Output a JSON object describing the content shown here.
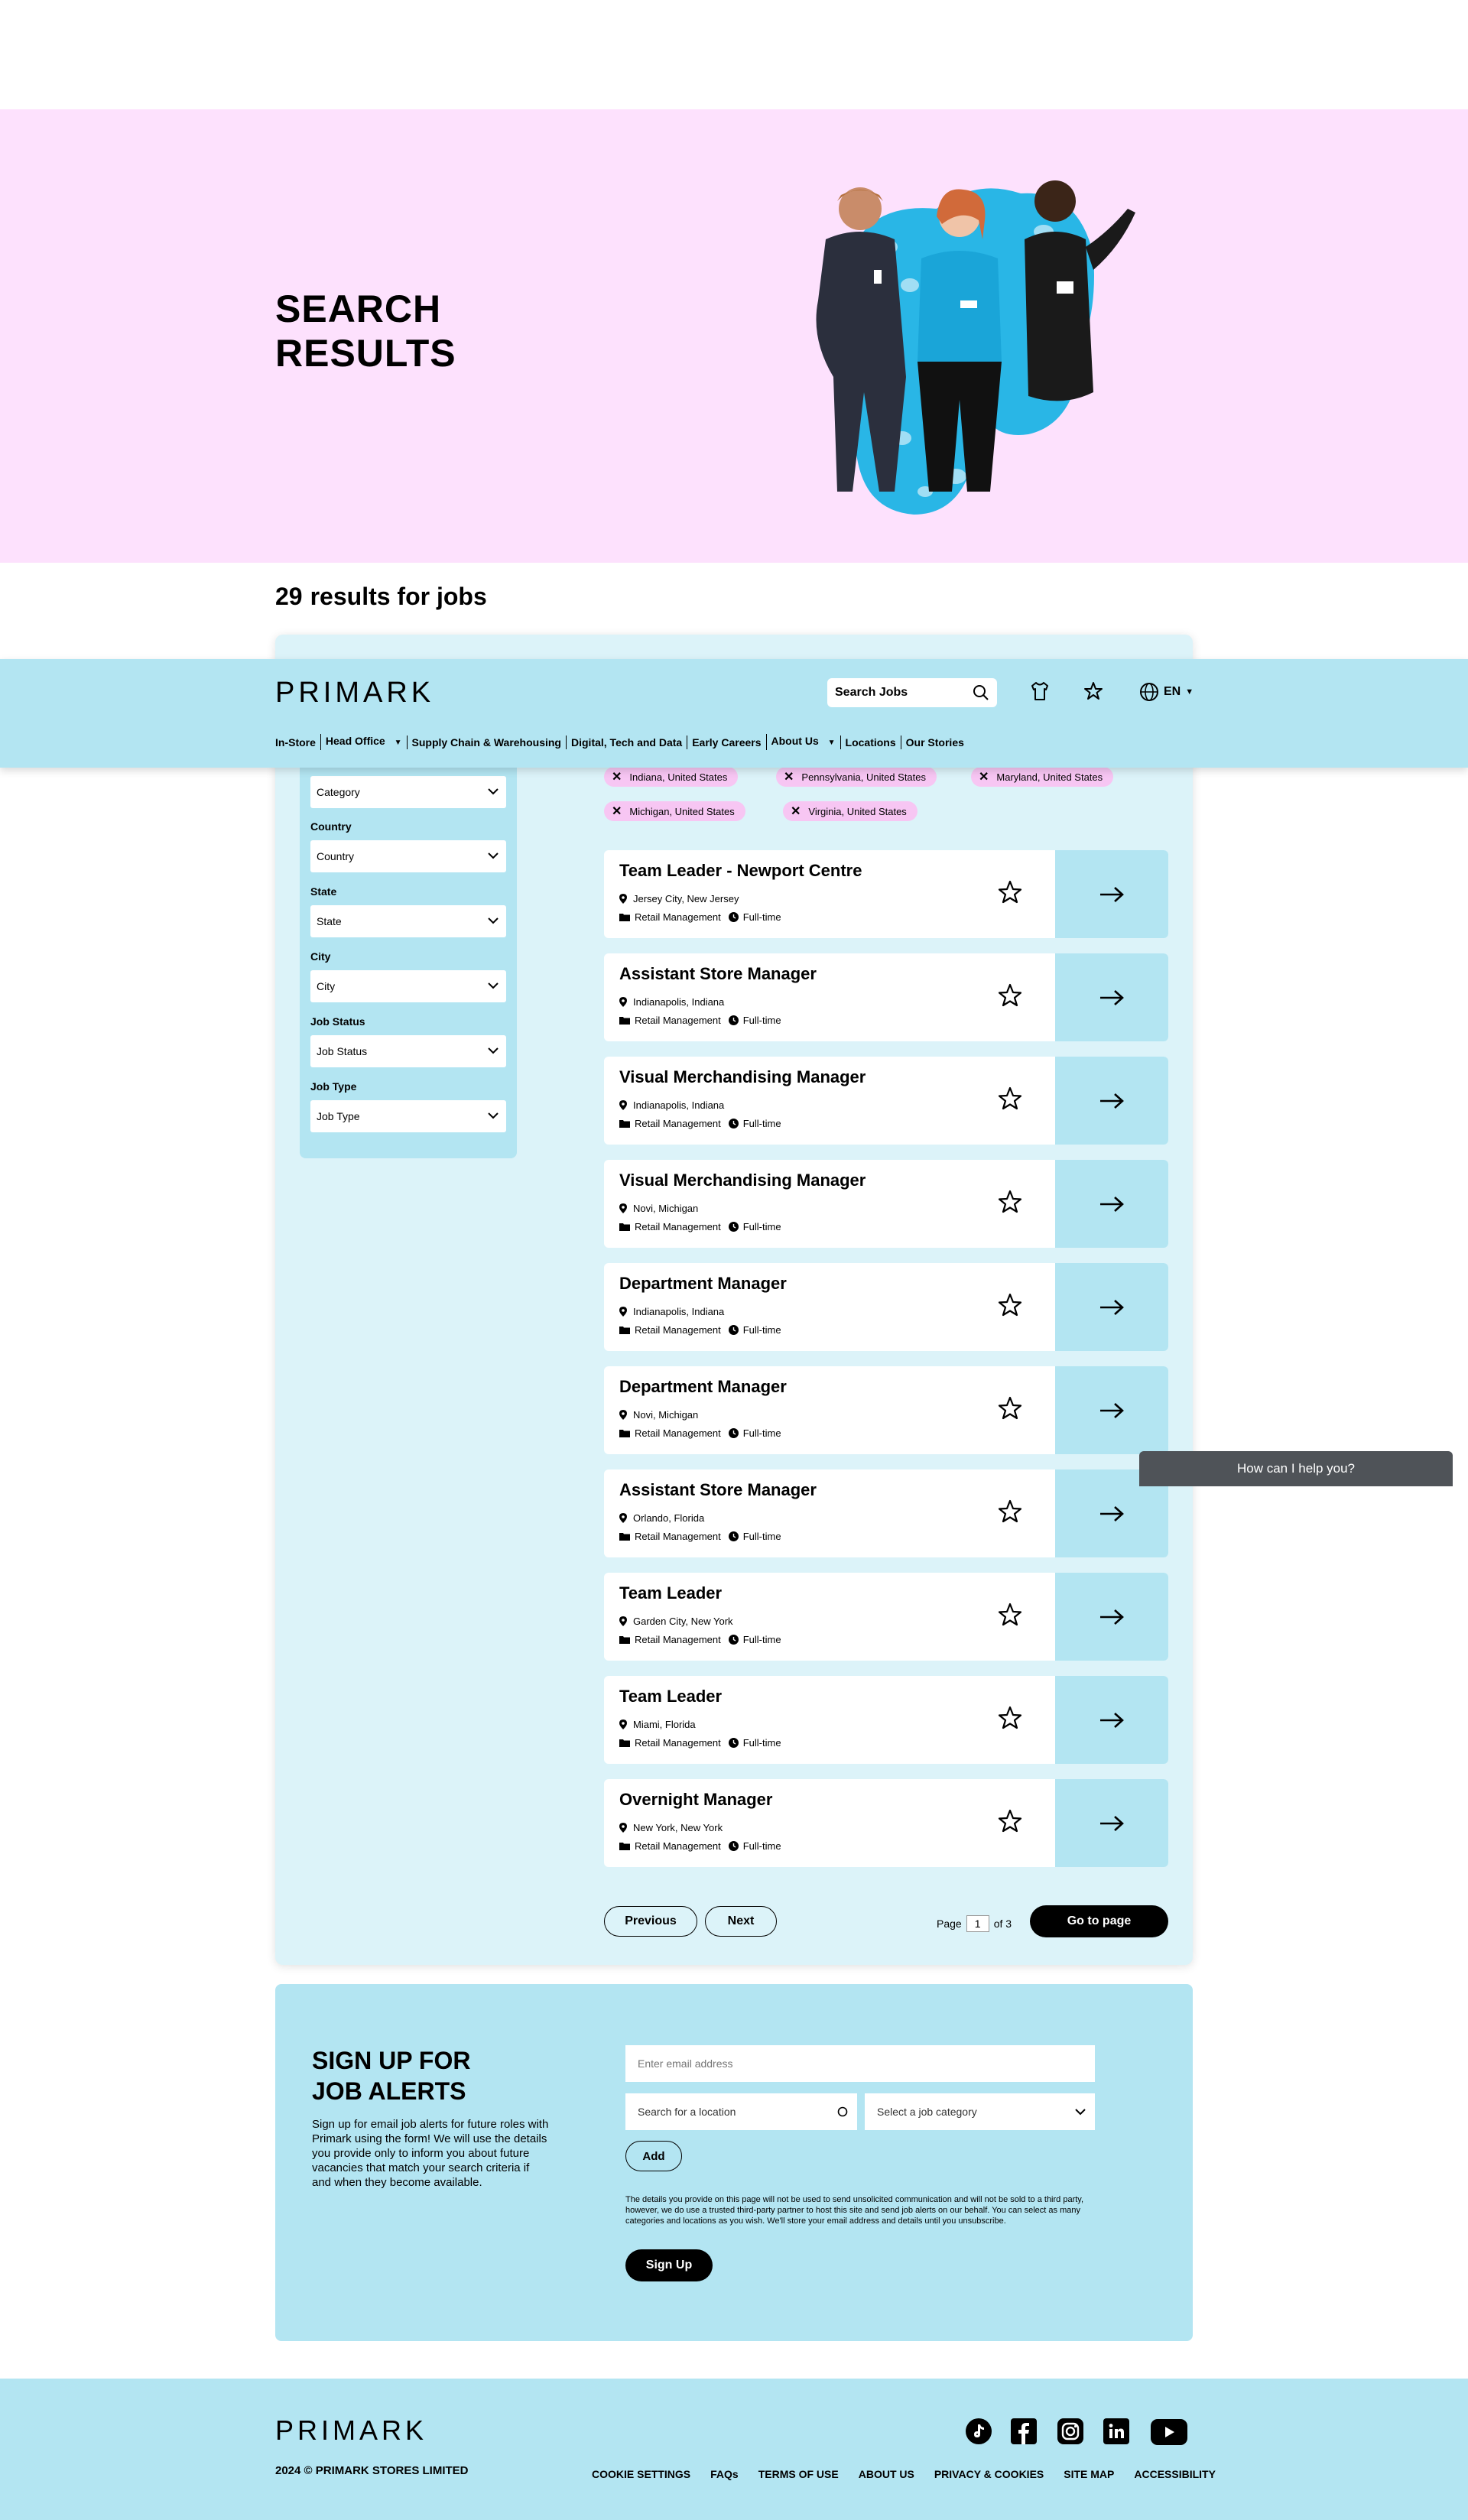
{
  "hero": {
    "title": "SEARCH\nRESULTS"
  },
  "results": {
    "count": "29",
    "label": "results for jobs"
  },
  "header": {
    "logo": "PRIMARK",
    "search_placeholder": "Search Jobs",
    "language": "EN",
    "nav": [
      "In-Store",
      "Head Office",
      "Supply Chain & Warehousing",
      "Digital, Tech and Data",
      "Early Careers",
      "About Us",
      "Locations",
      "Our Stories"
    ]
  },
  "filters": {
    "category_value": "Category",
    "country_label": "Country",
    "country_value": "Country",
    "state_label": "State",
    "state_value": "State",
    "city_label": "City",
    "city_value": "City",
    "job_status_label": "Job Status",
    "job_status_value": "Job Status",
    "job_type_label": "Job Type",
    "job_type_value": "Job Type"
  },
  "chips": [
    "Indiana, United States",
    "Pennsylvania, United States",
    "Maryland, United States",
    "Michigan, United States",
    "Virginia, United States"
  ],
  "jobs": [
    {
      "title": "Team Leader - Newport Centre",
      "location": "Jersey City, New Jersey",
      "category": "Retail Management",
      "type": "Full-time"
    },
    {
      "title": "Assistant Store Manager",
      "location": "Indianapolis, Indiana",
      "category": "Retail Management",
      "type": "Full-time"
    },
    {
      "title": "Visual Merchandising Manager",
      "location": "Indianapolis, Indiana",
      "category": "Retail Management",
      "type": "Full-time"
    },
    {
      "title": "Visual Merchandising Manager",
      "location": "Novi, Michigan",
      "category": "Retail Management",
      "type": "Full-time"
    },
    {
      "title": "Department Manager",
      "location": "Indianapolis, Indiana",
      "category": "Retail Management",
      "type": "Full-time"
    },
    {
      "title": "Department Manager",
      "location": "Novi, Michigan",
      "category": "Retail Management",
      "type": "Full-time"
    },
    {
      "title": "Assistant Store Manager",
      "location": "Orlando, Florida",
      "category": "Retail Management",
      "type": "Full-time"
    },
    {
      "title": "Team Leader",
      "location": "Garden City, New York",
      "category": "Retail Management",
      "type": "Full-time"
    },
    {
      "title": "Team Leader",
      "location": "Miami, Florida",
      "category": "Retail Management",
      "type": "Full-time"
    },
    {
      "title": "Overnight Manager",
      "location": "New York, New York",
      "category": "Retail Management",
      "type": "Full-time"
    }
  ],
  "pagination": {
    "previous": "Previous",
    "next": "Next",
    "page_label": "Page",
    "current": "1",
    "of_label": "of 3",
    "go": "Go to page"
  },
  "chat": {
    "label": "How can I help you?"
  },
  "signup": {
    "title": "SIGN UP FOR\nJOB ALERTS",
    "description": "Sign up for email job alerts for future roles with Primark using the form! We will use the details you provide only to inform you about future vacancies that match your search criteria if and when they become available.",
    "email_placeholder": "Enter email address",
    "location_placeholder": "Search for a location",
    "category_placeholder": "Select a job category",
    "add": "Add",
    "legal": "The details you provide on this page will not be used to send unsolicited communication and will not be sold to a third party, however, we do use a trusted third-party partner to host this site and send job alerts on our behalf. You can select as many categories and locations as you wish. We'll store your email address and details until you unsubscribe.",
    "button": "Sign Up"
  },
  "footer": {
    "logo": "PRIMARK",
    "copyright": "2024 © PRIMARK STORES LIMITED",
    "links": [
      "COOKIE SETTINGS",
      "FAQs",
      "TERMS OF USE",
      "ABOUT US",
      "PRIVACY & COOKIES",
      "SITE MAP",
      "ACCESSIBILITY"
    ]
  },
  "colors": {
    "hero_bg": "#fde1fd",
    "brand_blue": "#b3e5f2",
    "panel_bg": "#dcf3f9",
    "chip_pink": "#f7c6f3",
    "accent_cyan": "#29b6e6"
  }
}
